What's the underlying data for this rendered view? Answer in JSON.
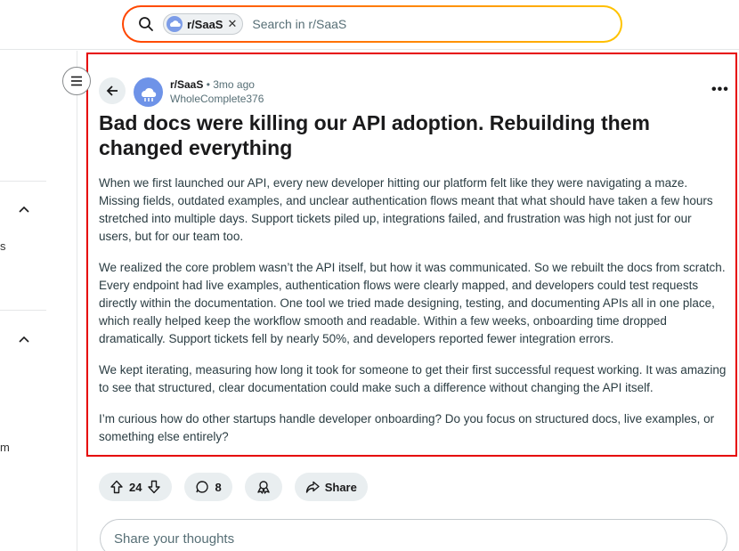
{
  "search": {
    "chip_label": "r/SaaS",
    "chip_close": "✕",
    "placeholder": "Search in r/SaaS"
  },
  "sidebar": {
    "fragments": [
      "s",
      "m"
    ]
  },
  "post": {
    "subreddit": "r/SaaS",
    "separator": "•",
    "time_ago": "3mo ago",
    "author": "WholeComplete376",
    "more": "•••",
    "title": "Bad docs were killing our API adoption. Rebuilding them changed everything",
    "paragraphs": [
      "When we first launched our API, every new developer hitting our platform felt like they were navigating a maze. Missing fields, outdated examples, and unclear authentication flows meant that what should have taken a few hours stretched into multiple days. Support tickets piled up, integrations failed, and frustration was high not just for our users, but for our team too.",
      "We realized the core problem wasn’t the API itself, but how it was communicated. So we rebuilt the docs from scratch. Every endpoint had live examples, authentication flows were clearly mapped, and developers could test requests directly within the documentation. One tool we tried made designing, testing, and documenting APIs all in one place, which really helped keep the workflow smooth and readable. Within a few weeks, onboarding time dropped dramatically. Support tickets fell by nearly 50%, and developers reported fewer integration errors.",
      "We kept iterating, measuring how long it took for someone to get their first successful request working. It was amazing to see that structured, clear documentation could make such a difference without changing the API itself.",
      "I’m curious how do other startups handle developer onboarding? Do you focus on structured docs, live examples, or something else entirely?"
    ]
  },
  "actions": {
    "votes": "24",
    "comments": "8",
    "share_label": "Share"
  },
  "comment": {
    "placeholder": "Share your thoughts"
  },
  "colors": {
    "highlight_border": "#e60000",
    "pill_bg": "#e9eef0",
    "avatar": "#6e93e8"
  }
}
